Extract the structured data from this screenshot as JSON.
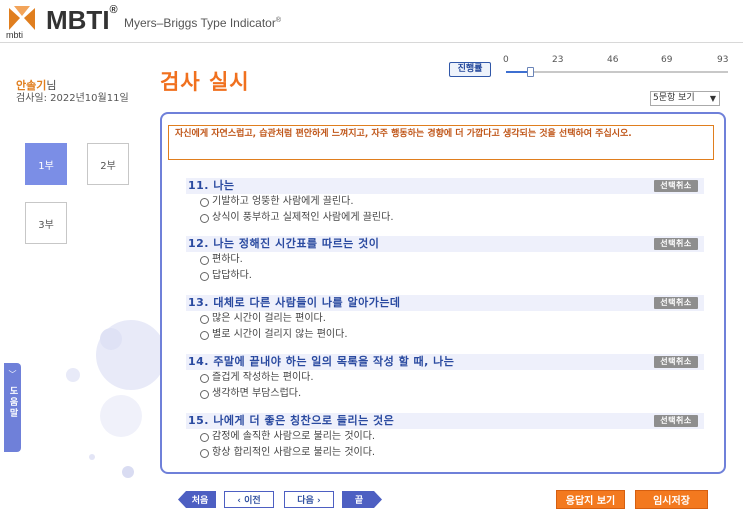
{
  "header": {
    "brand_small": "mbti",
    "brand": "MBTI",
    "brand_reg": "®",
    "subtitle": "Myers–Briggs Type Indicator",
    "subtitle_reg": "®"
  },
  "user": {
    "name": "안솔기",
    "name_suffix": "님",
    "date": "검사일: 2022년10월11일"
  },
  "page_title": "검사 실시",
  "progress": {
    "label": "진행률",
    "ticks": [
      "0",
      "23",
      "46",
      "69",
      "93"
    ],
    "current": 10,
    "max": 93
  },
  "view_select": {
    "value": "5문항 보기"
  },
  "parts": [
    {
      "label": "1부",
      "active": true
    },
    {
      "label": "2부",
      "active": false
    },
    {
      "label": "3부",
      "active": false
    }
  ],
  "help_tab": {
    "label": "도움말"
  },
  "instruction": "자신에게 자연스럽고, 습관처럼 편안하게 느껴지고, 자주 행동하는 경향에 더 가깝다고 생각되는 것을 선택하여 주십시오.",
  "cancel_label": "선택취소",
  "questions": [
    {
      "title": "11. 나는",
      "options": [
        "기발하고 엉뚱한 사람에게 끌린다.",
        "상식이 풍부하고 실제적인 사람에게 끌린다."
      ]
    },
    {
      "title": "12. 나는 정해진 시간표를 따르는 것이",
      "options": [
        "편하다.",
        "답답하다."
      ]
    },
    {
      "title": "13. 대체로 다른 사람들이 나를 알아가는데",
      "options": [
        "많은 시간이 걸리는 편이다.",
        "별로 시간이 걸리지 않는 편이다."
      ]
    },
    {
      "title": "14. 주말에 끝내야 하는 일의 목록을 작성 할 때, 나는",
      "options": [
        "즐겁게 작성하는 편이다.",
        "생각하면 부담스럽다."
      ]
    },
    {
      "title": "15. 나에게 더 좋은 칭찬으로 들리는 것은",
      "options": [
        "감정에 솔직한 사람으로 불리는 것이다.",
        "항상 합리적인 사람으로 불리는 것이다."
      ]
    }
  ],
  "nav": {
    "first": "처음",
    "prev": "‹ 이전",
    "next": "다음 ›",
    "last": "끝"
  },
  "buttons": {
    "answer_sheet": "응답지 보기",
    "temp_save": "임시저장"
  },
  "colors": {
    "accent_orange": "#f3791f",
    "accent_blue": "#6f80d9",
    "question_blue": "#2a4aa0"
  }
}
